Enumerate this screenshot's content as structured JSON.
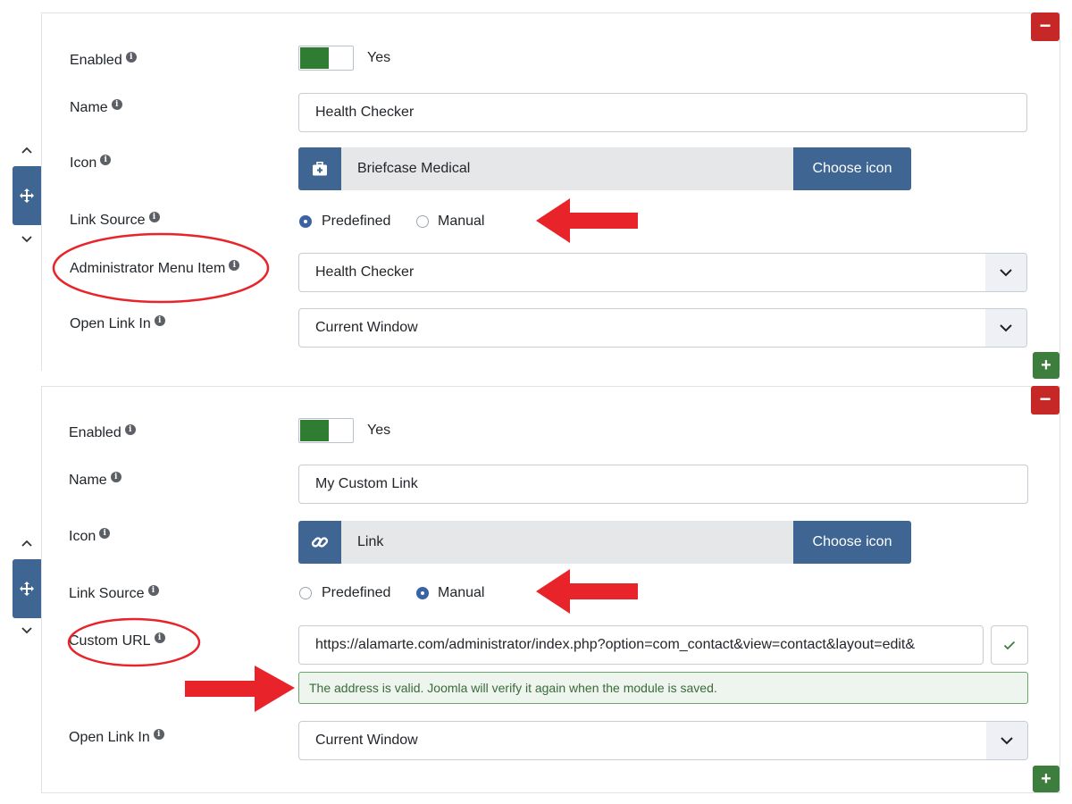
{
  "panel1": {
    "enabled_label": "Enabled",
    "enabled_value": "Yes",
    "name_label": "Name",
    "name_value": "Health Checker",
    "icon_label": "Icon",
    "icon_semantic": "briefcase-medical-icon",
    "icon_name": "Briefcase Medical",
    "choose_icon_label": "Choose icon",
    "link_source_label": "Link Source",
    "link_source_options": [
      "Predefined",
      "Manual"
    ],
    "link_source_selected": "Predefined",
    "menu_item_label": "Administrator Menu Item",
    "menu_item_value": "Health Checker",
    "open_link_label": "Open Link In",
    "open_link_value": "Current Window",
    "remove_label": "−",
    "add_label": "+"
  },
  "panel2": {
    "enabled_label": "Enabled",
    "enabled_value": "Yes",
    "name_label": "Name",
    "name_value": "My Custom Link",
    "icon_label": "Icon",
    "icon_semantic": "link-icon",
    "icon_name": "Link",
    "choose_icon_label": "Choose icon",
    "link_source_label": "Link Source",
    "link_source_options": [
      "Predefined",
      "Manual"
    ],
    "link_source_selected": "Manual",
    "custom_url_label": "Custom URL",
    "custom_url_value": "https://alamarte.com/administrator/index.php?option=com_contact&view=contact&layout=edit&",
    "validation_message": "The address is valid. Joomla will verify it again when the module is saved.",
    "open_link_label": "Open Link In",
    "open_link_value": "Current Window",
    "remove_label": "−",
    "add_label": "+"
  },
  "colors": {
    "toggle_on": "#2f7d32",
    "primary": "#3f6593",
    "danger": "#c52827",
    "success": "#3d7d3e",
    "annotation": "#e8242a"
  }
}
